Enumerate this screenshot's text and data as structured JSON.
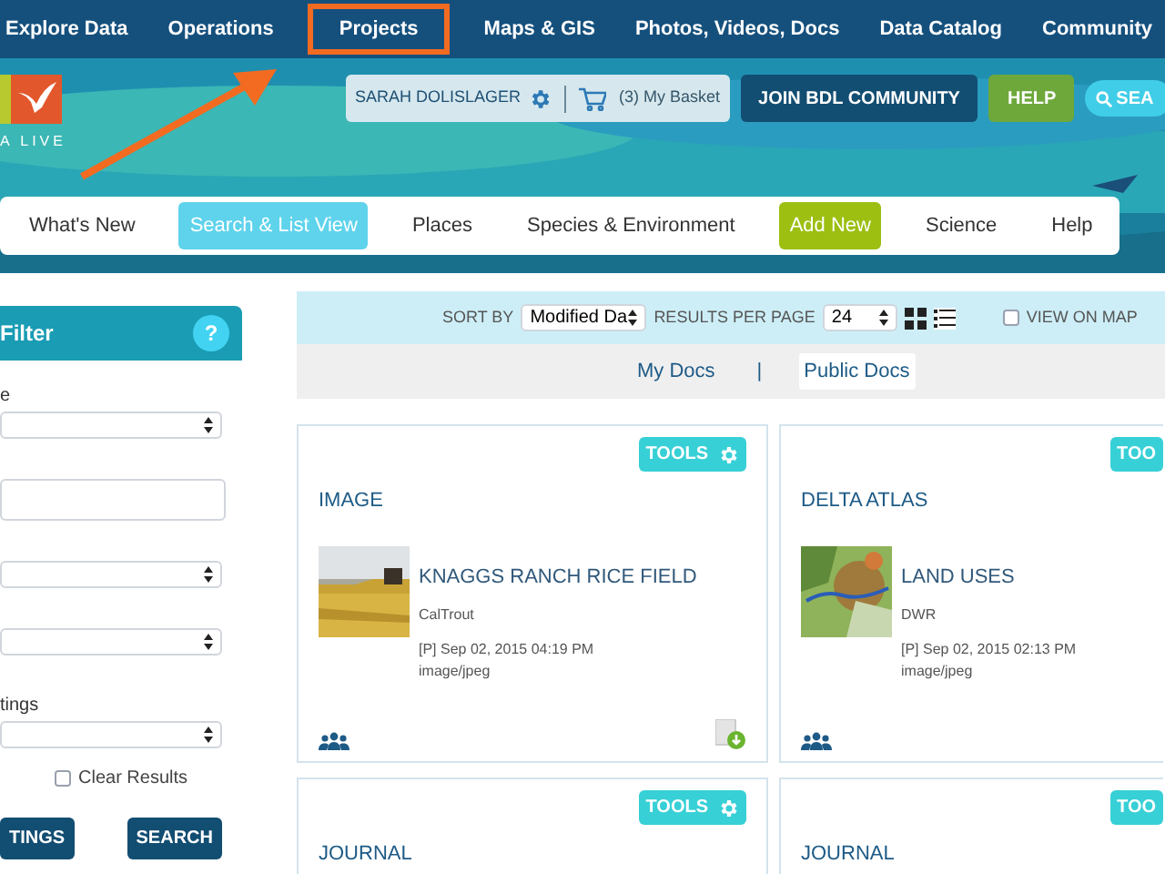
{
  "top_nav": [
    {
      "label": "Explore Data",
      "highlighted": false
    },
    {
      "label": "Operations",
      "highlighted": false
    },
    {
      "label": "Projects",
      "highlighted": true
    },
    {
      "label": "Maps & GIS",
      "highlighted": false
    },
    {
      "label": "Photos, Videos, Docs",
      "highlighted": false
    },
    {
      "label": "Data Catalog",
      "highlighted": false
    },
    {
      "label": "Community",
      "highlighted": false
    }
  ],
  "logo_text": "A LIVE",
  "user": {
    "name": "SARAH DOLISLAGER",
    "basket": "(3) My Basket"
  },
  "join_button": "JOIN BDL COMMUNITY",
  "help_button": "HELP",
  "search_button": "SEA",
  "sub_nav": [
    {
      "label": "What's New",
      "kind": "link",
      "selected": false
    },
    {
      "label": "Search & List View",
      "kind": "link",
      "selected": true
    },
    {
      "label": "Places",
      "kind": "link",
      "selected": false
    },
    {
      "label": "Species & Environment",
      "kind": "link",
      "selected": false
    },
    {
      "label": "Add New",
      "kind": "action",
      "selected": false
    },
    {
      "label": "Science",
      "kind": "link",
      "selected": false
    },
    {
      "label": "Help",
      "kind": "link",
      "selected": false
    }
  ],
  "filter": {
    "title": "Filter",
    "help": "?",
    "fields": [
      {
        "kind": "select",
        "label": "e"
      },
      {
        "kind": "text"
      },
      {
        "kind": "select"
      },
      {
        "kind": "select"
      },
      {
        "kind": "select",
        "label": "tings"
      }
    ],
    "clear_results": {
      "label": "Clear Results",
      "checked": false
    },
    "buttons": [
      "TINGS",
      "SEARCH"
    ]
  },
  "toolbar": {
    "sort_label": "SORT BY",
    "sort_value": "Modified Da",
    "per_page_label": "RESULTS PER PAGE",
    "per_page_value": "24",
    "view_on_map": {
      "label": "VIEW ON MAP",
      "checked": false
    }
  },
  "doc_tabs": [
    {
      "label": "My Docs",
      "selected": false
    },
    {
      "label": "Public Docs",
      "selected": true
    }
  ],
  "doc_tabs_separator": "|",
  "cards": [
    {
      "tools": "TOOLS",
      "category": "IMAGE",
      "title": "KNAGGS RANCH RICE FIELD",
      "source": "CalTrout",
      "date": "[P] Sep 02, 2015 04:19 PM",
      "type": "image/jpeg",
      "download": true
    },
    {
      "tools": "TOO",
      "category": "DELTA ATLAS",
      "title": "LAND USES",
      "source": "DWR",
      "date": "[P] Sep 02, 2015 02:13 PM",
      "type": "image/jpeg",
      "download": false
    },
    {
      "tools": "TOOLS",
      "category": "JOURNAL"
    },
    {
      "tools": "TOO",
      "category": "JOURNAL"
    }
  ]
}
